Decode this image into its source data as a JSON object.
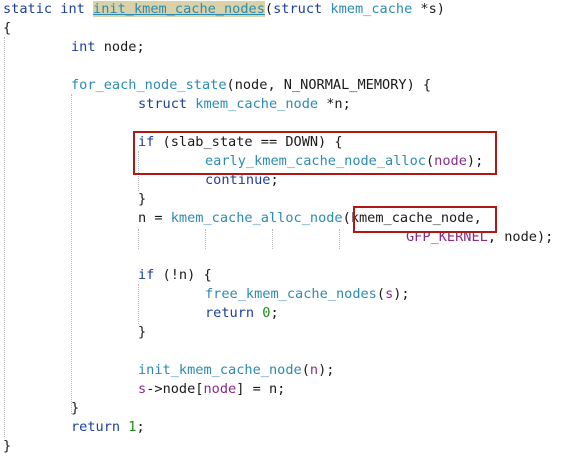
{
  "code": {
    "l1": {
      "kw_static": "static",
      "kw_int": "int",
      "fn_name": "init_kmem_cache_nodes",
      "p_open": "(",
      "kw_struct": "struct",
      "ty_cache": "kmem_cache",
      "arg": " *s)"
    },
    "l2": {
      "brace": "{"
    },
    "l3": {
      "kw_int": "int",
      "rest": " node;"
    },
    "l5": {
      "macro": "for_each_node_state",
      "open": "(",
      "arg1": "node",
      "mid": ", N_NORMAL_MEMORY) {"
    },
    "l6": {
      "kw_struct": "struct",
      "ty": "kmem_cache_node",
      "rest": " *n;"
    },
    "l8": {
      "kw_if": "if",
      "rest": " (slab_state == DOWN) {"
    },
    "l9": {
      "fn": "early_kmem_cache_node_alloc",
      "open": "(",
      "arg": "node",
      "close": ");"
    },
    "l10": {
      "kw": "continue",
      "rest": ";"
    },
    "l11": {
      "brace": "}"
    },
    "l12": {
      "pre": "n = ",
      "fn": "kmem_cache_alloc_node",
      "open": "(",
      "arg": "kmem_cache_node,"
    },
    "l13": {
      "const": "GFP_KERNEL",
      "rest": ", node);"
    },
    "l15": {
      "kw_if": "if",
      "rest": " (!n) {"
    },
    "l16": {
      "fn": "free_kmem_cache_nodes",
      "open": "(",
      "arg": "s",
      "close": ");"
    },
    "l17": {
      "kw": "return",
      "sp": " ",
      "num": "0",
      "close": ";"
    },
    "l18": {
      "brace": "}"
    },
    "l20": {
      "fn": "init_kmem_cache_node",
      "open": "(",
      "arg": "n",
      "close": ");"
    },
    "l21": {
      "pre": "s",
      "arrow": "->",
      "mid": "node[",
      "arg": "node",
      "close": "] = n;"
    },
    "l22": {
      "brace": "}"
    },
    "l23": {
      "kw": "return",
      "sp": " ",
      "num": "1",
      "close": ";"
    },
    "l24": {
      "brace": "}"
    }
  },
  "colors": {
    "keyword": "#1c3fa0",
    "type": "#2b8bb0",
    "param": "#8a2a8a",
    "number": "#1a8a1a",
    "annotation": "#b01818",
    "highlight": "#d9d2a8"
  }
}
